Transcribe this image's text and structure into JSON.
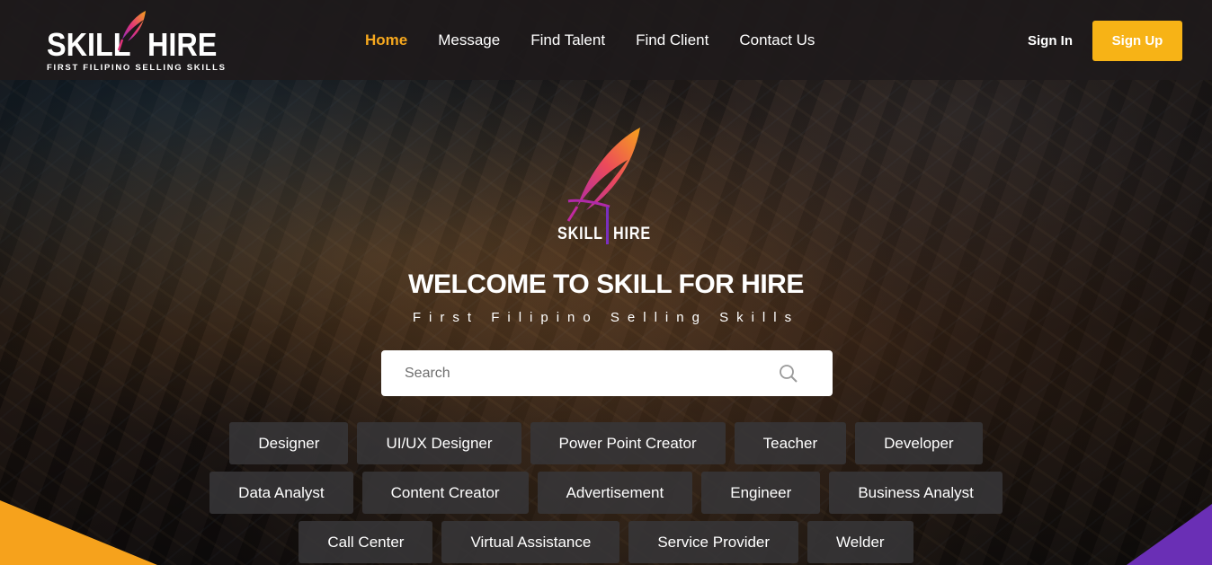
{
  "brand": {
    "logo_word_left": "SKILL",
    "logo_word_right": "HIRE",
    "tagline": "FIRST FILIPINO SELLING SKILLS",
    "accent": "#f7b316",
    "feather_gradient": [
      "#f6a21c",
      "#e0337a",
      "#8a2fc0"
    ]
  },
  "nav": {
    "items": [
      {
        "label": "Home",
        "active": true
      },
      {
        "label": "Message",
        "active": false
      },
      {
        "label": "Find Talent",
        "active": false
      },
      {
        "label": "Find Client",
        "active": false
      },
      {
        "label": "Contact Us",
        "active": false
      }
    ],
    "signin_label": "Sign In",
    "signup_label": "Sign Up"
  },
  "hero": {
    "logo_left": "SKILL",
    "logo_right": "HIRE",
    "title": "WELCOME TO SKILL FOR HIRE",
    "subtitle": "First Filipino Selling Skills"
  },
  "search": {
    "placeholder": "Search",
    "icon": "search-icon"
  },
  "categories": {
    "row1": [
      "Designer",
      "UI/UX Designer",
      "Power Point Creator",
      "Teacher",
      "Developer"
    ],
    "row2": [
      "Data Analyst",
      "Content Creator",
      "Advertisement",
      "Engineer",
      "Business Analyst"
    ],
    "row3": [
      "Call Center",
      "Virtual Assistance",
      "Service Provider",
      "Welder"
    ]
  }
}
